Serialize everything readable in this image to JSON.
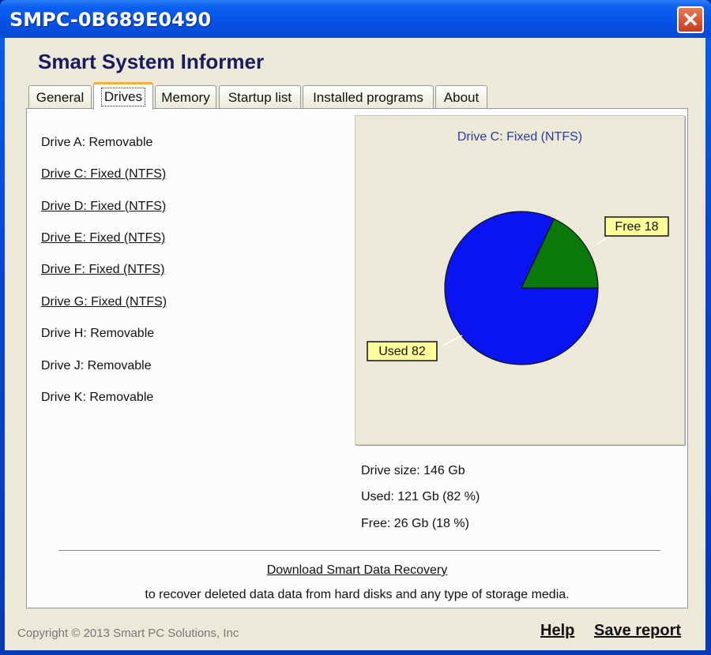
{
  "window": {
    "title": "SMPC-0B689E0490",
    "close_label": "✕"
  },
  "app": {
    "title": "Smart System Informer"
  },
  "tabs": [
    {
      "label": "General",
      "active": false
    },
    {
      "label": "Drives",
      "active": true
    },
    {
      "label": "Memory",
      "active": false
    },
    {
      "label": "Startup list",
      "active": false
    },
    {
      "label": "Installed programs",
      "active": false
    },
    {
      "label": "About",
      "active": false
    }
  ],
  "drives": [
    {
      "label": "Drive A: Removable",
      "link": false
    },
    {
      "label": "Drive C: Fixed (NTFS)",
      "link": true
    },
    {
      "label": "Drive D: Fixed (NTFS)",
      "link": true
    },
    {
      "label": "Drive E: Fixed (NTFS)",
      "link": true
    },
    {
      "label": "Drive F: Fixed (NTFS)",
      "link": true
    },
    {
      "label": "Drive G: Fixed (NTFS)",
      "link": true
    },
    {
      "label": "Drive H: Removable",
      "link": false
    },
    {
      "label": "Drive J: Removable",
      "link": false
    },
    {
      "label": "Drive K: Removable",
      "link": false
    }
  ],
  "chart_data": {
    "type": "pie",
    "title": "Drive C: Fixed (NTFS)",
    "categories": [
      "Used",
      "Free"
    ],
    "values": [
      82,
      18
    ],
    "labels": [
      "Used 82",
      "Free 18"
    ],
    "colors": [
      "#0a14f0",
      "#0a780a"
    ],
    "label_background": "#ffff99"
  },
  "stats": {
    "drive_size": "Drive size: 146 Gb",
    "used": "Used: 121 Gb (82 %)",
    "free": "Free: 26 Gb (18 %)"
  },
  "promo": {
    "link": "Download Smart Data Recovery",
    "description": "to recover deleted data data from hard disks and any type of storage media."
  },
  "footer": {
    "copyright": "Copyright © 2013 Smart PC Solutions, Inc",
    "help": "Help",
    "save_report": "Save report"
  }
}
